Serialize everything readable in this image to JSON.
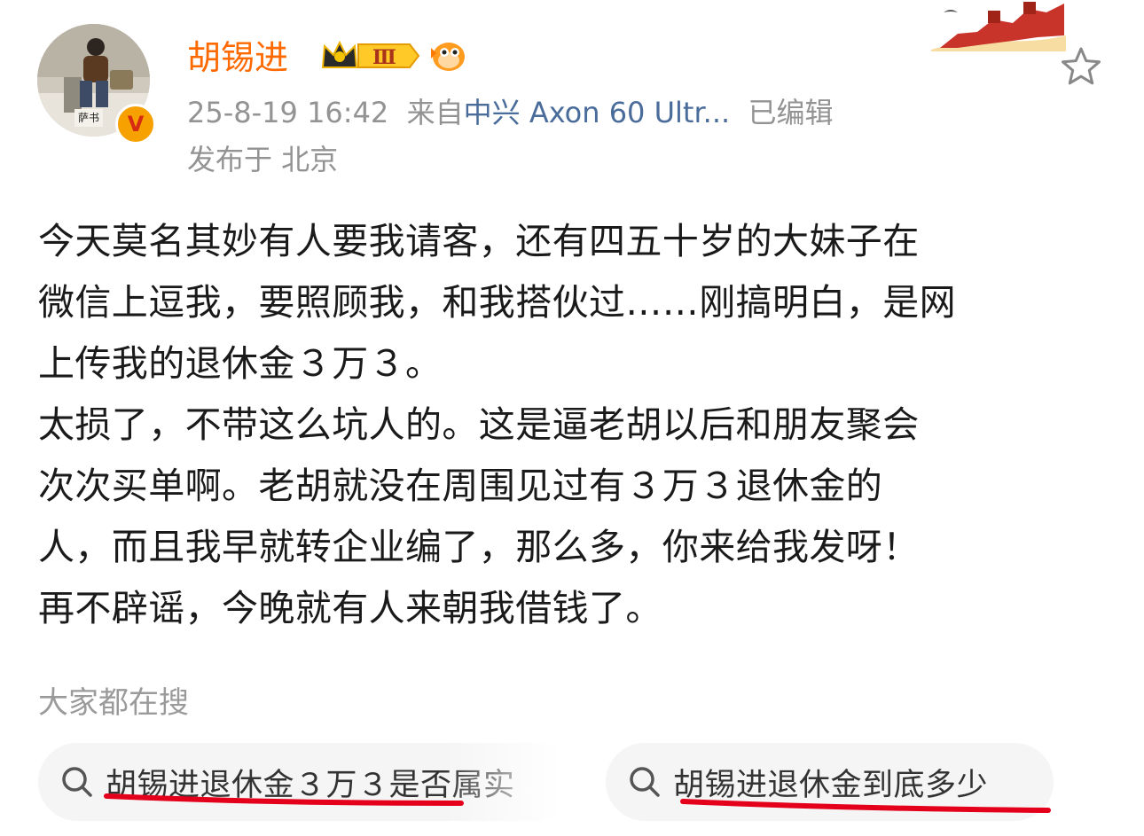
{
  "post": {
    "username": "胡锡进",
    "vip_level": "Ⅲ",
    "verified_mark": "V",
    "timestamp": "25-8-19 16:42",
    "source_prefix": "来自",
    "source_device": "中兴 Axon 60 Ultr...",
    "edited": "已编辑",
    "location": "发布于 北京",
    "body_lines": [
      "今天莫名其妙有人要我请客，还有四五十岁的大妹子在",
      "微信上逗我，要照顾我，和我搭伙过……刚搞明白，是网",
      "上传我的退休金３万３。",
      "太损了，不带这么坑人的。这是逼老胡以后和朋友聚会",
      "次次买单啊。老胡就没在周围见过有３万３退休金的",
      "人，而且我早就转企业编了，那么多，你来给我发呀！",
      "再不辟谣，今晚就有人来朝我借钱了。"
    ]
  },
  "search": {
    "heading": "大家都在搜",
    "chips": [
      {
        "label": "胡锡进退休金３万３是否属实",
        "icon": "search-icon"
      },
      {
        "label": "胡锡进退休金到底多少",
        "icon": "search-icon"
      }
    ]
  },
  "colors": {
    "username": "#ff6a00",
    "source_link": "#4a6c9b",
    "meta_gray": "#939393",
    "chip_bg": "#f5f5f5",
    "underline_red": "#e4001b"
  }
}
